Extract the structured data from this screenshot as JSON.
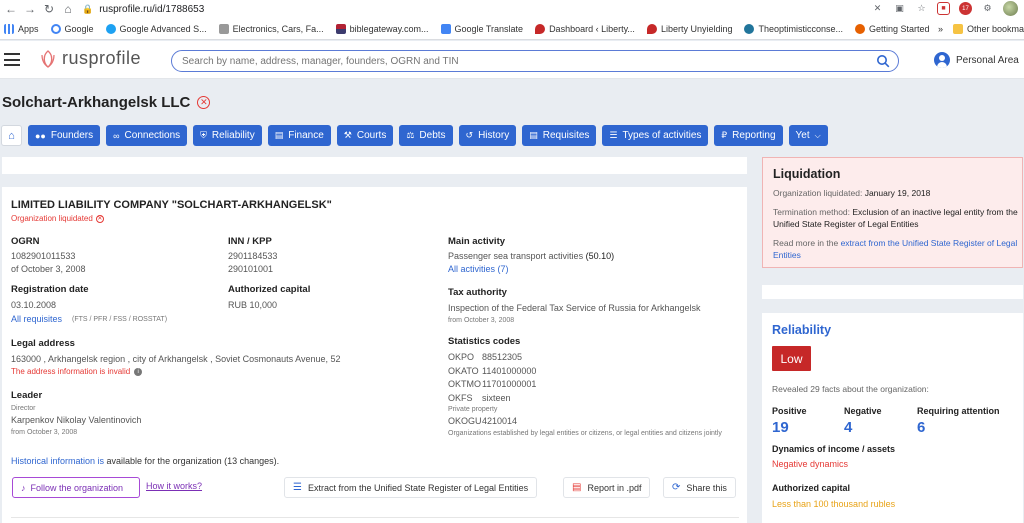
{
  "browser": {
    "url": "rusprofile.ru/id/1788653",
    "bookmarks": [
      "Apps",
      "Google",
      "Google Advanced S...",
      "Electronics, Cars, Fa...",
      "biblegateway.com...",
      "Google Translate",
      "Dashboard ‹ Liberty...",
      "Liberty Unyielding",
      "Theoptimisticconse...",
      "Getting Started"
    ],
    "bookmarks_more": "»",
    "other_bookmarks": "Other bookma",
    "badge_count": "17"
  },
  "header": {
    "logo_text": "rusprofile",
    "search_placeholder": "Search by name, address, manager, founders, OGRN and TIN",
    "personal_area": "Personal Area"
  },
  "company": {
    "title": "Solchart-Arkhangelsk LLC"
  },
  "tabs": [
    {
      "label": "Founders",
      "icon": "users-icon"
    },
    {
      "label": "Connections",
      "icon": "link-icon"
    },
    {
      "label": "Reliability",
      "icon": "shield-icon"
    },
    {
      "label": "Finance",
      "icon": "chart-icon"
    },
    {
      "label": "Courts",
      "icon": "gavel-icon"
    },
    {
      "label": "Debts",
      "icon": "scales-icon"
    },
    {
      "label": "History",
      "icon": "history-icon"
    },
    {
      "label": "Requisites",
      "icon": "document-icon"
    },
    {
      "label": "Types of activities",
      "icon": "list-icon"
    },
    {
      "label": "Reporting",
      "icon": "ruble-icon"
    },
    {
      "label": "Yet",
      "icon": "chevron-down-icon"
    }
  ],
  "main": {
    "full_name": "LIMITED LIABILITY COMPANY \"SOLCHART-ARKHANGELSK\"",
    "status": "Organization liquidated",
    "ogrn_label": "OGRN",
    "ogrn_value": "1082901011533",
    "ogrn_date": "of October 3, 2008",
    "inn_label": "INN / KPP",
    "inn_value": "2901184533",
    "kpp_value": "290101001",
    "reg_label": "Registration date",
    "reg_value": "03.10.2008",
    "all_requisites": "All requisites",
    "requisites_note": "(FTS / PFR / FSS / ROSSTAT)",
    "capital_label": "Authorized capital",
    "capital_value": "RUB 10,000",
    "address_label": "Legal address",
    "address_value": "163000 , Arkhangelsk region , city of Arkhangelsk , Soviet Cosmonauts Avenue, 52",
    "address_invalid": "The address information is invalid",
    "leader_label": "Leader",
    "leader_role": "Director",
    "leader_name": "Karpenkov Nikolay Valentinovich",
    "leader_date": "from October 3, 2008",
    "activity_label": "Main activity",
    "activity_value": "Passenger sea transport activities",
    "activity_code": "(50.10)",
    "all_activities": "All activities (7)",
    "tax_label": "Tax authority",
    "tax_value": "Inspection of the Federal Tax Service of Russia for Arkhangelsk",
    "tax_date": "from October 3, 2008",
    "stats_label": "Statistics codes",
    "codes": [
      {
        "k": "OKPO",
        "v": "88512305"
      },
      {
        "k": "OKATO",
        "v": "11401000000"
      },
      {
        "k": "OKTMO",
        "v": "11701000001"
      },
      {
        "k": "OKFS",
        "v": "sixteen"
      }
    ],
    "private_property": "Private property",
    "okogu": {
      "k": "OKOGU",
      "v": "4210014"
    },
    "okogu_note": "Organizations established by legal entities or citizens, or legal entities and citizens jointly",
    "history_link": "Historical information is",
    "history_text": " available for the organization (13 changes).",
    "follow": "Follow the organization",
    "how_it_works": "How it works?",
    "extract_btn": "Extract from the Unified State Register of Legal Entities",
    "report_btn": "Report in .pdf",
    "share_btn": "Share this"
  },
  "liquidation": {
    "title": "Liquidation",
    "liquidated_label": "Organization liquidated:",
    "liquidated_date": "January 19, 2018",
    "method_label": "Termination method:",
    "method_value": "Exclusion of an inactive legal entity from the Unified State Register of Legal Entities",
    "more_text": "Read more in the",
    "more_link": "extract from the Unified State Register of Legal Entities"
  },
  "reliability": {
    "title": "Reliability",
    "level": "Low",
    "facts": "Revealed 29 facts about the organization:",
    "positive_label": "Positive",
    "positive_count": "19",
    "negative_label": "Negative",
    "negative_count": "4",
    "attention_label": "Requiring attention",
    "attention_count": "6",
    "dynamics_label": "Dynamics of income / assets",
    "dynamics_value": "Negative dynamics",
    "capital_label": "Authorized capital",
    "capital_value": "Less than 100 thousand rubles"
  },
  "colors": {
    "primary": "#2f66d0",
    "danger": "#e53935",
    "low_badge": "#c62828",
    "warning": "#e8a317",
    "follow": "#7b2fb5"
  }
}
